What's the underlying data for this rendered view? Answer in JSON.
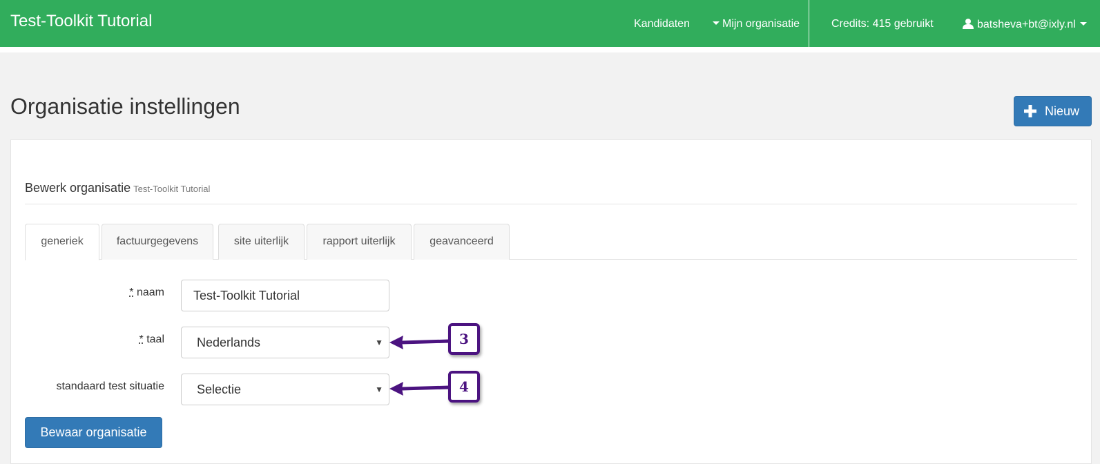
{
  "navbar": {
    "brand": "Test-Toolkit Tutorial",
    "links": {
      "kandidaten": "Kandidaten",
      "organisatie": "Mijn organisatie",
      "credits": "Credits: 415 gebruikt",
      "user": "batsheva+bt@ixly.nl"
    },
    "color": "#31ad5c"
  },
  "page": {
    "title": "Organisatie instellingen",
    "new_button": "Nieuw"
  },
  "panel": {
    "heading": "Bewerk organisatie",
    "heading_sub": "Test-Toolkit Tutorial",
    "tabs": [
      "generiek",
      "factuurgegevens",
      "site uiterlijk",
      "rapport uiterlijk",
      "geavanceerd"
    ],
    "active_tab": "generiek"
  },
  "form": {
    "naam": {
      "required_mark": "*",
      "label": " naam",
      "value": "Test-Toolkit Tutorial"
    },
    "taal": {
      "required_mark": "*",
      "label": " taal",
      "value": "Nederlands"
    },
    "test_situatie": {
      "label": "standaard test situatie",
      "value": "Selectie"
    },
    "save_button": "Bewaar organisatie"
  },
  "annotations": {
    "badge_3": "3",
    "badge_4": "4",
    "color": "#4b1380"
  }
}
